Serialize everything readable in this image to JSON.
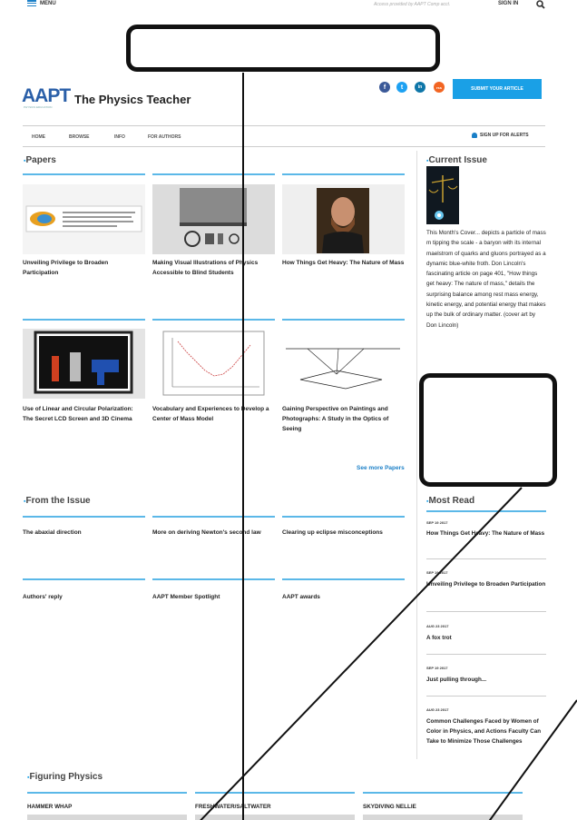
{
  "topbar": {
    "menu_label": "MENU",
    "access_text": "Access provided by AAPT Comp acct.",
    "signin_label": "SIGN IN"
  },
  "header": {
    "logo_text": "AAPT",
    "logo_subtext": "PHYSICS EDUCATION",
    "journal_title": "The Physics Teacher",
    "social": [
      "f",
      "t",
      "in",
      "rss"
    ],
    "submit_label": "SUBMIT YOUR ARTICLE"
  },
  "nav": {
    "items": [
      "HOME",
      "BROWSE",
      "INFO",
      "FOR AUTHORS"
    ],
    "alerts_label": "SIGN UP FOR ALERTS"
  },
  "papers": {
    "title": "Papers",
    "cards": [
      {
        "title": "Unveiling Privilege to Broaden Participation"
      },
      {
        "title": "Making Visual Illustrations of Physics Accessible to Blind Students"
      },
      {
        "title": "How Things Get Heavy: The Nature of Mass"
      },
      {
        "title": "Use of Linear and Circular Polarization: The Secret LCD Screen and 3D Cinema"
      },
      {
        "title": "Vocabulary and Experiences to Develop a Center of Mass Model"
      },
      {
        "title": "Gaining Perspective on Paintings and Photographs: A Study in the Optics of Seeing"
      }
    ],
    "see_more": "See more Papers"
  },
  "current_issue": {
    "title": "Current Issue",
    "description": "This Month's Cover... depicts a particle of mass m tipping the scale - a baryon with its internal maelstrom of quarks and gluons portrayed as a dynamic blue-white froth. Don Lincoln's fascinating article on page 401, \"How things get heavy: The nature of mass,\" details the surprising balance among rest mass energy, kinetic energy, and potential energy that makes up the bulk of ordinary matter. (cover art by Don Lincoln)"
  },
  "from_issue": {
    "title": "From the Issue",
    "items": [
      "The abaxial direction",
      "More on deriving Newton's second law",
      "Clearing up eclipse misconceptions",
      "Authors' reply",
      "AAPT Member Spotlight",
      "AAPT awards"
    ]
  },
  "most_read": {
    "title": "Most Read",
    "items": [
      {
        "date": "SEP 19 2017",
        "title": "How Things Get Heavy: The Nature of Mass"
      },
      {
        "date": "SEP 19 2017",
        "title": "Unveiling Privilege to Broaden Participation"
      },
      {
        "date": "AUG 23 2017",
        "title": "A fox trot"
      },
      {
        "date": "SEP 19 2017",
        "title": "Just pulling through..."
      },
      {
        "date": "AUG 23 2017",
        "title": "Common Challenges Faced by Women of Color in Physics, and Actions Faculty Can Take to Minimize Those Challenges"
      }
    ]
  },
  "figuring": {
    "title": "Figuring Physics",
    "items": [
      "HAMMER WHAP",
      "FRESHWATER/SALTWATER",
      "SKYDIVING NELLIE"
    ]
  },
  "colors": {
    "accent": "#1aa0e6",
    "brand_blue": "#2a5fa8",
    "facebook": "#3b5998",
    "twitter": "#1da1f2",
    "linkedin": "#0e76a8",
    "rss": "#f26522"
  }
}
